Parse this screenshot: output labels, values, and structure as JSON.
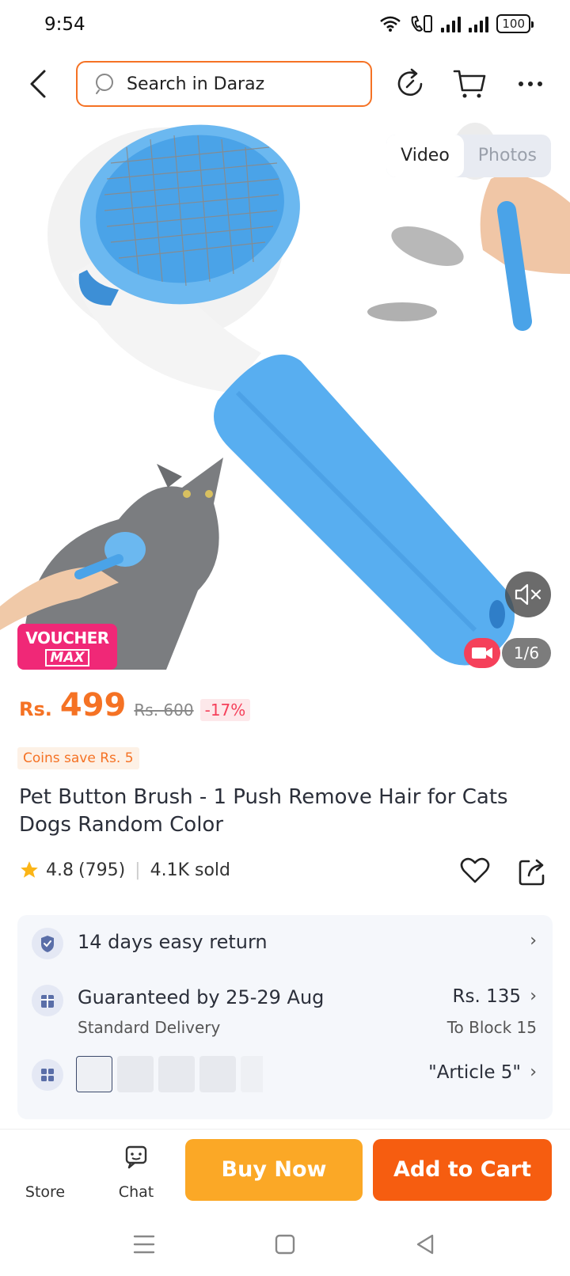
{
  "status": {
    "time": "9:54",
    "battery": "100"
  },
  "search": {
    "placeholder": "Search in Daraz"
  },
  "gallery": {
    "tabs": [
      {
        "label": "Video",
        "active": true
      },
      {
        "label": "Photos",
        "active": false
      }
    ],
    "counter": "1/6",
    "voucher_line1": "VOUCHER",
    "voucher_line2": "MAX"
  },
  "price": {
    "currency": "Rs.",
    "current": "499",
    "original": "Rs. 600",
    "discount": "-17%",
    "coins": "Coins save Rs. 5"
  },
  "product": {
    "title": "Pet Button Brush - 1 Push Remove Hair for Cats Dogs Random Color",
    "rating": "4.8",
    "reviews": "(795)",
    "sold": "4.1K sold"
  },
  "info": {
    "returns": "14 days easy return",
    "delivery_title": "Guaranteed by 25-29 Aug",
    "delivery_type": "Standard Delivery",
    "delivery_fee": "Rs. 135",
    "delivery_location": "To Block 15",
    "variant_label": "\"Article 5\""
  },
  "actions": {
    "store": "Store",
    "chat": "Chat",
    "buy_now": "Buy Now",
    "add_to_cart": "Add to Cart"
  },
  "colors": {
    "brand_orange": "#f57224",
    "buy_now": "#fba826",
    "add_to_cart": "#f65d10",
    "voucher": "#f02877"
  }
}
